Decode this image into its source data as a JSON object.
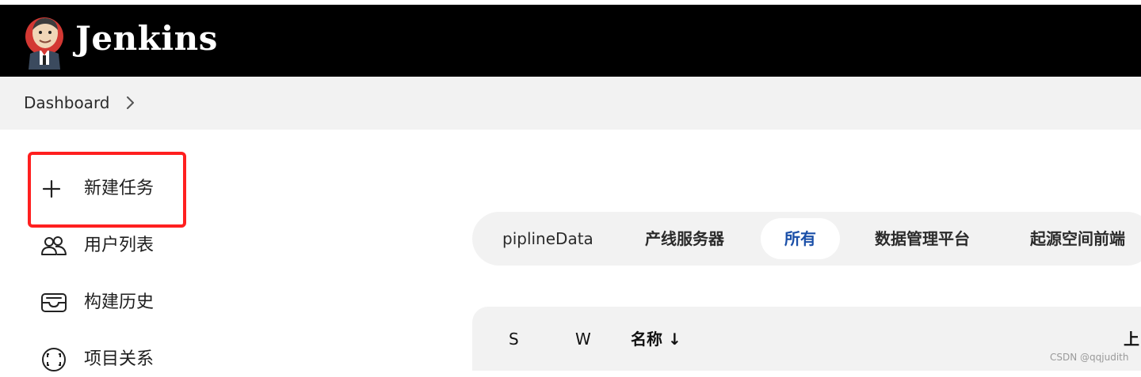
{
  "header": {
    "brand": "Jenkins",
    "logo_icon": "jenkins-butler-logo"
  },
  "breadcrumb": {
    "items": [
      "Dashboard"
    ],
    "separator_icon": "chevron-right-icon"
  },
  "sidebar": {
    "items": [
      {
        "label": "新建任务",
        "icon": "plus-icon"
      },
      {
        "label": "用户列表",
        "icon": "users-icon"
      },
      {
        "label": "构建历史",
        "icon": "inbox-icon"
      },
      {
        "label": "项目关系",
        "icon": "relationship-icon"
      }
    ],
    "highlight_color": "#ff1f1f"
  },
  "view_tabs": {
    "items": [
      "piplineData",
      "产线服务器",
      "所有",
      "数据管理平台",
      "起源空间前端"
    ],
    "active": "所有",
    "active_color": "#1a4fa8"
  },
  "table": {
    "columns": [
      "S",
      "W",
      "名称 ↓",
      "上"
    ]
  },
  "watermark": "CSDN @qqjudith"
}
